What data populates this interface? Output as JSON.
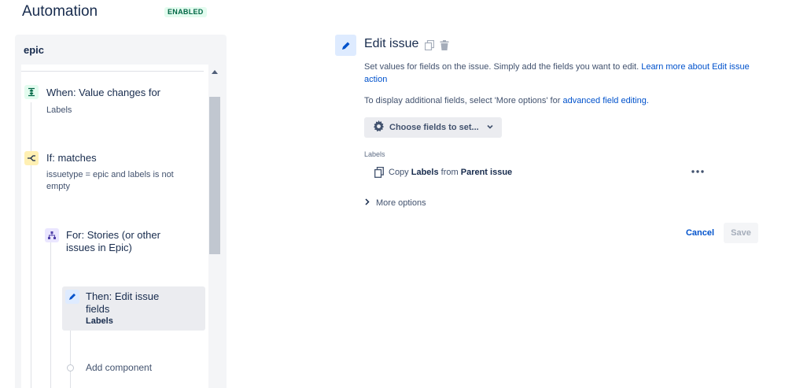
{
  "header": {
    "title": "Automation",
    "status": "ENABLED"
  },
  "rule": {
    "name": "epic",
    "components": [
      {
        "type": "trigger",
        "icon": "trigger-icon",
        "title": "When: Value changes for",
        "subtitle": "Labels"
      },
      {
        "type": "condition",
        "icon": "condition-icon",
        "title": "If: matches",
        "subtitle": "issuetype = epic and labels is not empty"
      },
      {
        "type": "branch",
        "icon": "branch-icon",
        "title": "For: Stories (or other issues in Epic)"
      },
      {
        "type": "action",
        "icon": "pencil-icon",
        "title": "Then: Edit issue fields",
        "subtitle": "Labels"
      }
    ],
    "add_component": "Add component"
  },
  "editor": {
    "title": "Edit issue",
    "desc1_text": "Set values for fields on the issue. Simply add the fields you want to edit.",
    "desc1_link": "Learn more about Edit issue action",
    "desc2_text": "To display additional fields, select 'More options' for",
    "desc2_link": "advanced field editing.",
    "choose_fields": "Choose fields to set...",
    "field_label": "Labels",
    "copy": {
      "prefix": "Copy",
      "field": "Labels",
      "from": "from",
      "source": "Parent issue"
    },
    "more_options": "More options",
    "cancel": "Cancel",
    "save": "Save"
  },
  "colors": {
    "accent": "#0052cc",
    "enabled_bg": "#e3fcef",
    "enabled_text": "#006644",
    "trigger_bg": "#e3fcef",
    "condition_bg": "#fff0b3",
    "branch_bg": "#eae6ff",
    "action_bg": "#deebff"
  }
}
